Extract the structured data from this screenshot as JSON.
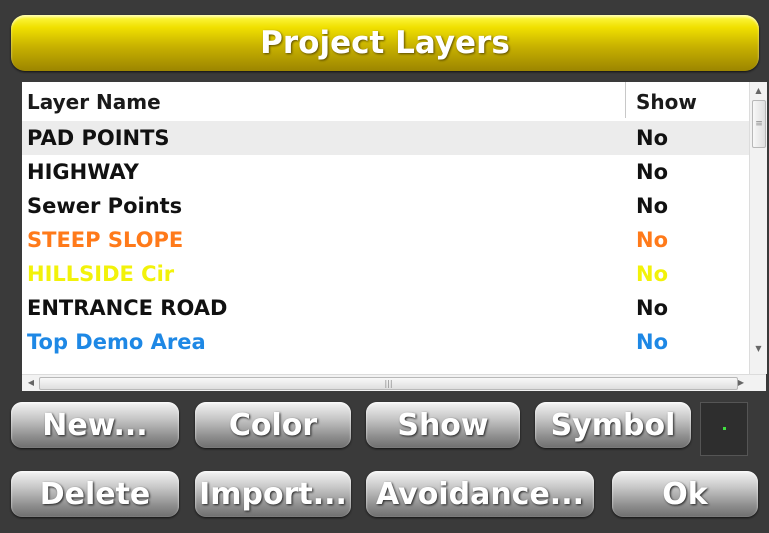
{
  "title": "Project Layers",
  "list": {
    "header": {
      "name": "Layer Name",
      "show": "Show"
    },
    "rows": [
      {
        "name": "PAD POINTS",
        "show": "No",
        "color": "#111111",
        "selected": true
      },
      {
        "name": "HIGHWAY",
        "show": "No",
        "color": "#111111"
      },
      {
        "name": "Sewer Points",
        "show": "No",
        "color": "#111111"
      },
      {
        "name": "STEEP SLOPE",
        "show": "No",
        "color": "#ff7a1a"
      },
      {
        "name": "HILLSIDE Cir",
        "show": "No",
        "color": "#f2f20a"
      },
      {
        "name": "ENTRANCE ROAD",
        "show": "No",
        "color": "#111111"
      },
      {
        "name": "Top Demo Area",
        "show": "No",
        "color": "#1e88e5"
      }
    ]
  },
  "buttons": {
    "new": "New...",
    "color": "Color",
    "show": "Show",
    "symbol": "Symbol",
    "delete": "Delete",
    "import": "Import...",
    "avoidance": "Avoidance...",
    "ok": "Ok"
  },
  "colors": {
    "title_bar": "#e8d400",
    "selected_row": "#ececec"
  }
}
